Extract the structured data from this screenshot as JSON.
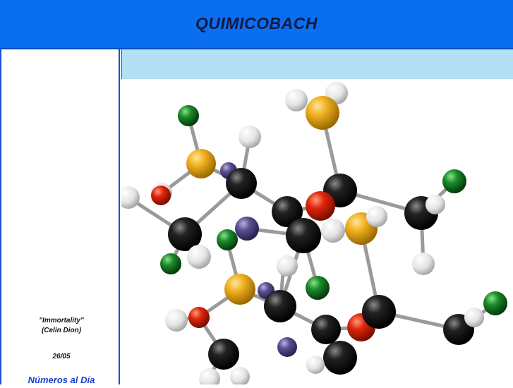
{
  "header": {
    "title": "QUIMICOBACH"
  },
  "sidebar": {
    "song_title": "\"Immortality\"",
    "song_artist": "(Celin Dion)",
    "date": "26/05",
    "link_label": "Números al Día"
  },
  "main": {
    "image_icon": "molecule-model-icon"
  },
  "colors": {
    "header_bg": "#0a6ef0",
    "sidebar_border": "#1a4fd6",
    "content_bar_bg": "#b3e0f5",
    "link": "#1f3fd0"
  }
}
